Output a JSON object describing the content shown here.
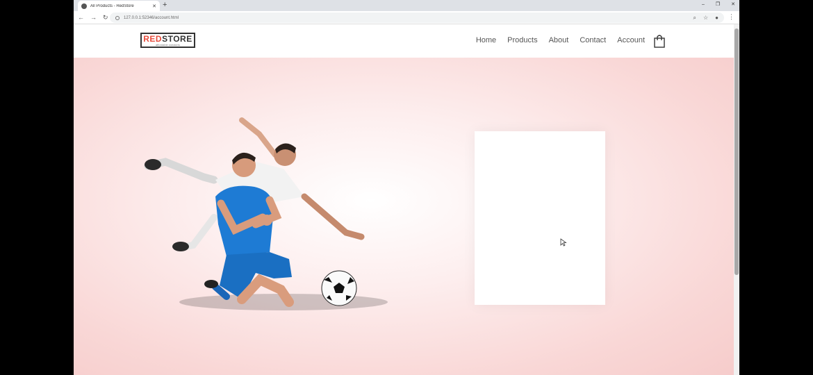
{
  "browser": {
    "tab_title": "All Products - RedStore",
    "url": "127.0.0.1:52346/account.html"
  },
  "site": {
    "logo": {
      "part1": "RED",
      "part2": "STORE",
      "tagline": "affordable sneakers"
    },
    "nav": [
      "Home",
      "Products",
      "About",
      "Contact",
      "Account"
    ]
  },
  "icons": {
    "favicon": "globe-icon",
    "cart": "shopping-bag-icon",
    "cursor": "mouse-pointer-icon"
  },
  "colors": {
    "brand_red": "#e74c3c",
    "hero_pink": "#f9d7d6",
    "player_blue": "#1e7bd4"
  }
}
